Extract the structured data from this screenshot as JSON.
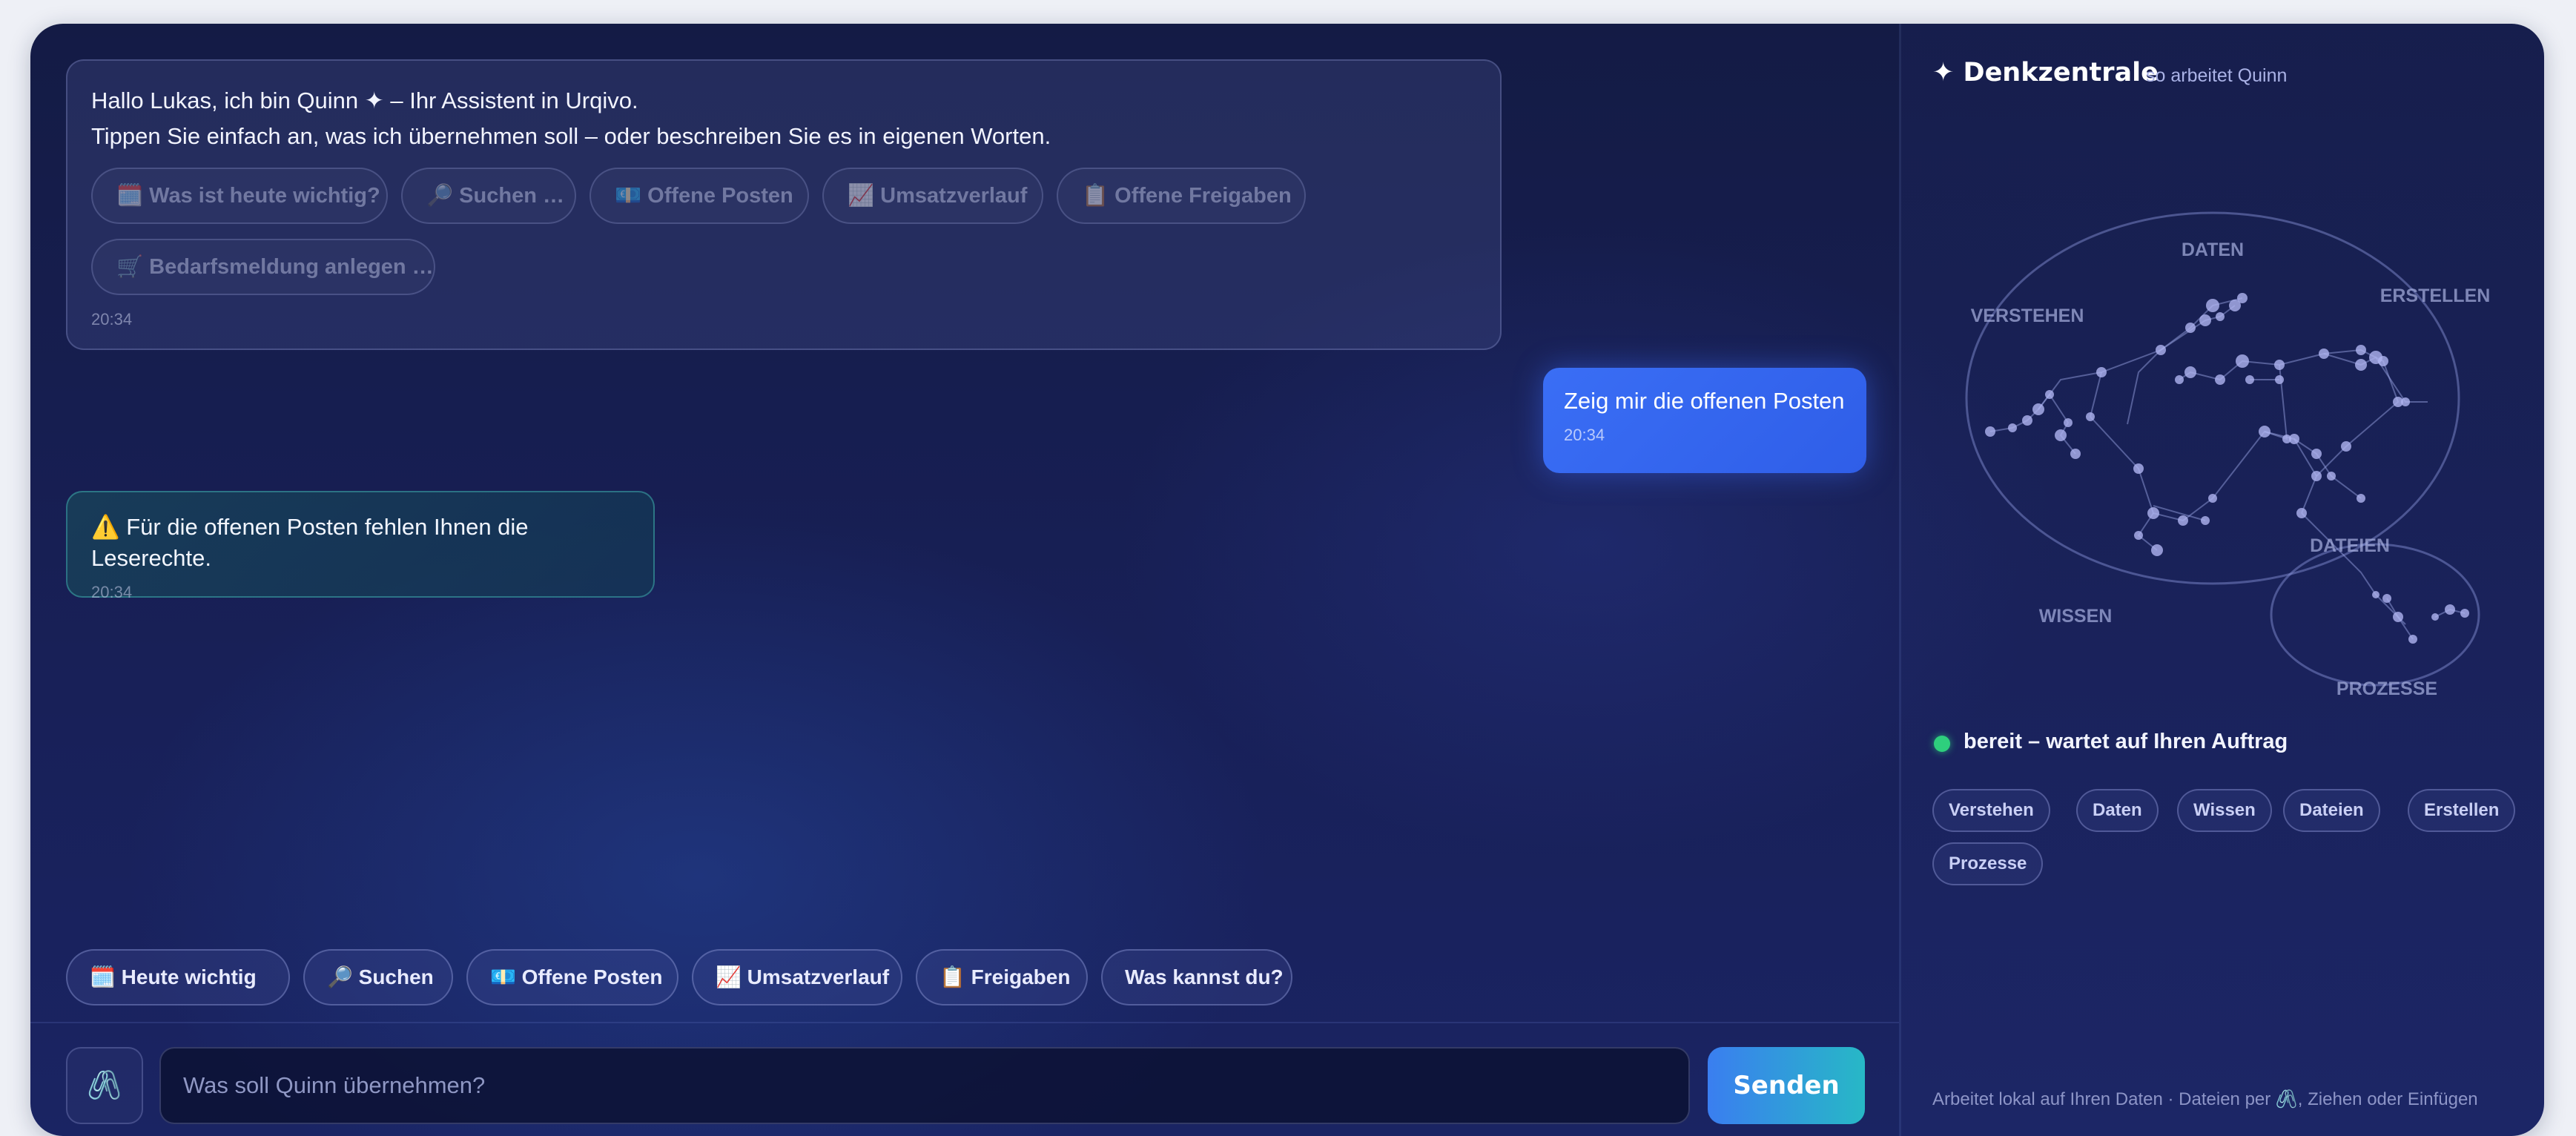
{
  "chat": {
    "greeting": {
      "line1": "Hallo Lukas, ich bin Quinn ✦ – Ihr Assistent in Urqivo.",
      "line2": "Tippen Sie einfach an, was ich übernehmen soll – oder beschreiben Sie es in eigenen Worten.",
      "chips": [
        {
          "icon": "🗓️",
          "label": "Was ist heute wichtig?"
        },
        {
          "icon": "🔎",
          "label": "Suchen …"
        },
        {
          "icon": "💶",
          "label": "Offene Posten"
        },
        {
          "icon": "📈",
          "label": "Umsatzverlauf"
        },
        {
          "icon": "📋",
          "label": "Offene Freigaben"
        },
        {
          "icon": "🛒",
          "label": "Bedarfsmeldung anlegen …"
        }
      ],
      "time": "20:34"
    },
    "user_message": {
      "text": "Zeig mir die offenen Posten",
      "time": "20:34"
    },
    "warning_message": {
      "text": "⚠️ Für die offenen Posten fehlen Ihnen die Leserechte.",
      "time": "20:34"
    }
  },
  "quick_actions": [
    {
      "icon": "🗓️",
      "label": "Heute wichtig"
    },
    {
      "icon": "🔎",
      "label": "Suchen"
    },
    {
      "icon": "💶",
      "label": "Offene Posten"
    },
    {
      "icon": "📈",
      "label": "Umsatzverlauf"
    },
    {
      "icon": "📋",
      "label": "Freigaben"
    },
    {
      "icon": "",
      "label": "Was kannst du?"
    }
  ],
  "composer": {
    "attach_icon": "🖇️",
    "placeholder": "Was soll Quinn übernehmen?",
    "send_label": "Senden"
  },
  "side": {
    "title": "✦ Denkzentrale",
    "subtitle": "so arbeitet Quinn",
    "diagram_labels": {
      "daten": "DATEN",
      "erstellen": "ERSTELLEN",
      "verstehen": "VERSTEHEN",
      "dateien": "DATEIEN",
      "wissen": "WISSEN",
      "prozesse": "PROZESSE"
    },
    "status": "bereit – wartet auf Ihren Auftrag",
    "tags": [
      "Verstehen",
      "Daten",
      "Wissen",
      "Dateien",
      "Erstellen",
      "Prozesse"
    ],
    "footnote": "Arbeitet lokal auf Ihren Daten · Dateien per 🖇️, Ziehen oder Einfügen"
  },
  "colors": {
    "accent_blue": "#3a6ef5",
    "send_gradient": [
      "#3a7ef0",
      "#27b8c6"
    ],
    "status_ready": "#2ecf7d",
    "background": "#182058"
  }
}
